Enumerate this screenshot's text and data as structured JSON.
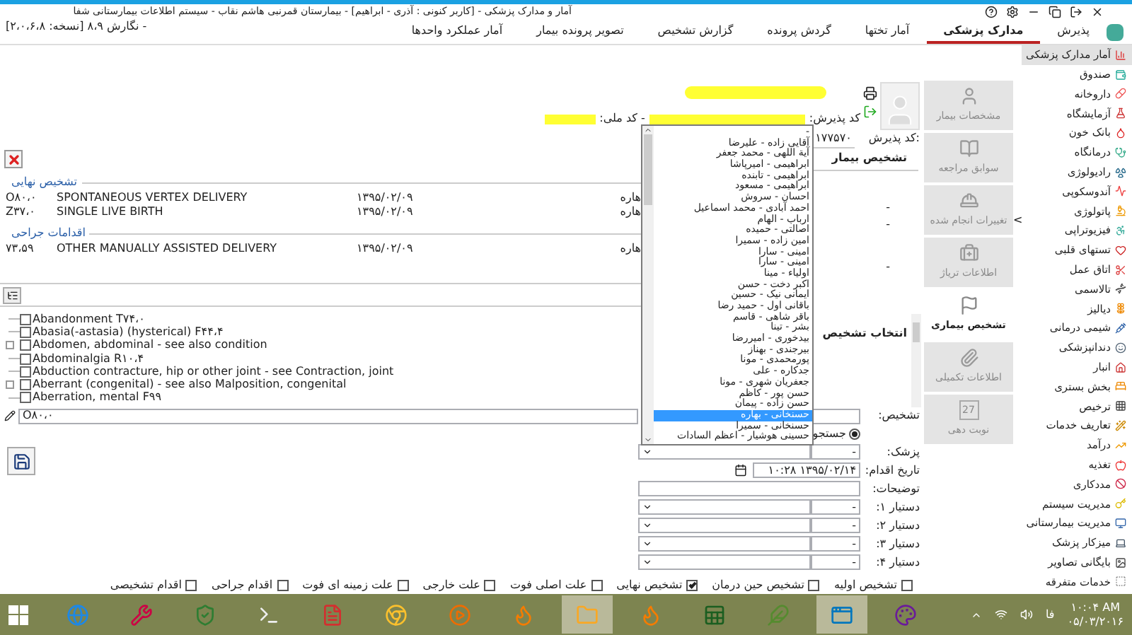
{
  "window": {
    "title": "آمار و مدارک پزشکی - [کاربر کنونی : آذری - ابراهیم] - بیمارستان قمرنبی هاشم نقاب - سیستم اطلاعات بیمارستانی شفا",
    "title_continuation": "- نگارش ۸،۹ [نسخه: ۲،۰،۶،۸]"
  },
  "menu_tabs": [
    {
      "label": "پذیرش",
      "selected": false
    },
    {
      "label": "مدارک پزشکی",
      "selected": true
    },
    {
      "label": "آمار تختها",
      "selected": false
    },
    {
      "label": "گردش پرونده",
      "selected": false
    },
    {
      "label": "گزارش تشخیص",
      "selected": false
    },
    {
      "label": "تصویر پرونده بیمار",
      "selected": false
    },
    {
      "label": "آمار عملکرد واحدها",
      "selected": false
    }
  ],
  "patient": {
    "info_label": "کد پذیرش:",
    "national_id_label": "- کد ملی:",
    "admission_label": "کد پذیرش:",
    "admission_value": "۱۷۷۵۷۰"
  },
  "diagnosis_groups": [
    {
      "title": "تشخیص نهایی",
      "rows": [
        {
          "code": "O۸۰،۰",
          "description": "SPONTANEOUS VERTEX DELIVERY",
          "date": "۱۳۹۵/۰۲/۰۹",
          "column_4": "هاره"
        },
        {
          "code": "Z۳۷،۰",
          "description": "SINGLE LIVE BIRTH",
          "date": "۱۳۹۵/۰۲/۰۹",
          "column_4": "هاره"
        }
      ]
    },
    {
      "title": "اقدامات جراحی",
      "rows": [
        {
          "code": "۷۳،۵۹",
          "description": "OTHER MANUALLY ASSISTED DELIVERY",
          "date": "۱۳۹۵/۰۲/۰۹",
          "column_4": "هاره"
        }
      ]
    }
  ],
  "patient_diagnosis": {
    "title": "تشخیص بیمار",
    "dashes": [
      "-",
      "-",
      "-"
    ]
  },
  "diagnosis_tree": [
    {
      "label": "Abandonment T۷۴،۰",
      "checked": false,
      "expandable": false
    },
    {
      "label": "Abasia(-astasia) (hysterical) F۴۴،۴",
      "checked": false,
      "expandable": false
    },
    {
      "label": "Abdomen, abdominal - see also condition",
      "checked": false,
      "expandable": true
    },
    {
      "label": "Abdominalgia R۱۰،۴",
      "checked": false,
      "expandable": false
    },
    {
      "label": "Abduction contracture, hip or other joint - see Contraction, joint",
      "checked": false,
      "expandable": false
    },
    {
      "label": "Aberrant (congenital) - see also Malposition, congenital",
      "checked": false,
      "expandable": true
    },
    {
      "label": "Aberration, mental F۹۹",
      "checked": false,
      "expandable": false
    }
  ],
  "code_input": {
    "value": "O۸۰،۰"
  },
  "select_diagnosis": {
    "title": "انتخاب تشخیص"
  },
  "collapse_arrow": "<",
  "form": {
    "diagnosis_label": "تشخیص:",
    "search_radio": {
      "label": "جستجو",
      "selected": true
    },
    "doctor_label": "پزشک:",
    "doctor_code": "-",
    "date_label": "تاریخ اقدام:",
    "date_value": "۱۳۹۵/۰۲/۱۴ ۱۰:۲۸",
    "notes_label": "توضیحات:",
    "assistants": [
      {
        "label": "دستیار ۱:",
        "code": "-"
      },
      {
        "label": "دستیار ۲:",
        "code": "-"
      },
      {
        "label": "دستیار ۳:",
        "code": "-"
      },
      {
        "label": "دستیار ۴:",
        "code": "-"
      }
    ]
  },
  "diagnosis_types": [
    {
      "label": "تشخیص اولیه",
      "checked": false
    },
    {
      "label": "تشخیص حین درمان",
      "checked": false
    },
    {
      "label": "تشخیص نهایی",
      "checked": true
    },
    {
      "label": "علت اصلی فوت",
      "checked": false
    },
    {
      "label": "علت خارجی",
      "checked": false
    },
    {
      "label": "علت زمینه ای فوت",
      "checked": false
    },
    {
      "label": "اقدام جراحی",
      "checked": false
    },
    {
      "label": "اقدام تشخیصی",
      "checked": false
    }
  ],
  "doctor_dropdown": {
    "items": [
      {
        "label": "-",
        "selected": false
      },
      {
        "label": "آقایی زاده - علیرضا",
        "selected": false
      },
      {
        "label": "آیة اللهی - محمد جعفر",
        "selected": false
      },
      {
        "label": "ابراهیمی - امیرپاشا",
        "selected": false
      },
      {
        "label": "ابراهیمی - تابنده",
        "selected": false
      },
      {
        "label": "ابراهیمی - مسعود",
        "selected": false
      },
      {
        "label": "احسان - سروش",
        "selected": false
      },
      {
        "label": "احمد آبادی - محمد اسماعیل",
        "selected": false
      },
      {
        "label": "ارباب - الهام",
        "selected": false
      },
      {
        "label": "اصالتی - حمیده",
        "selected": false
      },
      {
        "label": "امین زاده - سمیرا",
        "selected": false
      },
      {
        "label": "امینی - سارا",
        "selected": false
      },
      {
        "label": "امینی - سارا",
        "selected": false
      },
      {
        "label": "اولیاء - مینا",
        "selected": false
      },
      {
        "label": "اکبر دخت - حسن",
        "selected": false
      },
      {
        "label": "ایمانی نیک - حسین",
        "selected": false
      },
      {
        "label": "باقانی اول - حمید رضا",
        "selected": false
      },
      {
        "label": "باقر شاهی - قاسم",
        "selected": false
      },
      {
        "label": "بشر - تینا",
        "selected": false
      },
      {
        "label": "بیدخوری - امیررضا",
        "selected": false
      },
      {
        "label": "بیرجندی - بهناز",
        "selected": false
      },
      {
        "label": "پورمحمدی - مونا",
        "selected": false
      },
      {
        "label": "جدکاره - علی",
        "selected": false
      },
      {
        "label": "جعفریان شهری - مونا",
        "selected": false
      },
      {
        "label": "حسن پور - کاظم",
        "selected": false
      },
      {
        "label": "حسن زاده - پیمان",
        "selected": false
      },
      {
        "label": "حسنخانی - بهاره",
        "selected": true
      },
      {
        "label": "حسنخانی - سمیرا",
        "selected": false
      },
      {
        "label": "حسینی هوشیار - اعظم السادات",
        "selected": false
      }
    ]
  },
  "nav_panel": [
    {
      "label": "مشخصات بیمار",
      "selected": false
    },
    {
      "label": "سوابق مراجعه",
      "selected": false
    },
    {
      "label": "تغییرات انجام شده",
      "selected": false
    },
    {
      "label": "اطلاعات تریاژ",
      "selected": false
    },
    {
      "label": "تشخیص بیماری",
      "selected": true
    },
    {
      "label": "اطلاعات تکمیلی",
      "selected": false
    },
    {
      "label": "نوبت دهی",
      "selected": false
    }
  ],
  "calendar_day": "27",
  "sidebar": {
    "items": [
      {
        "label": "آمار مدارک پزشکی",
        "selected": true
      },
      {
        "label": "صندوق",
        "selected": false
      },
      {
        "label": "داروخانه",
        "selected": false
      },
      {
        "label": "آزمایشگاه",
        "selected": false
      },
      {
        "label": "بانک خون",
        "selected": false
      },
      {
        "label": "درمانگاه",
        "selected": false
      },
      {
        "label": "رادیولوژی",
        "selected": false
      },
      {
        "label": "آندوسکوپی",
        "selected": false
      },
      {
        "label": "پاتولوژی",
        "selected": false
      },
      {
        "label": "فیزیوتراپی",
        "selected": false
      },
      {
        "label": "تستهای قلبی",
        "selected": false
      },
      {
        "label": "اتاق عمل",
        "selected": false
      },
      {
        "label": "تالاسمی",
        "selected": false
      },
      {
        "label": "دیالیز",
        "selected": false
      },
      {
        "label": "شیمی درمانی",
        "selected": false
      },
      {
        "label": "دندانپزشکی",
        "selected": false
      },
      {
        "label": "انبار",
        "selected": false
      },
      {
        "label": "بخش بستری",
        "selected": false
      },
      {
        "label": "ترخیص",
        "selected": false
      },
      {
        "label": "تعاریف خدمات",
        "selected": false
      },
      {
        "label": "درآمد",
        "selected": false
      },
      {
        "label": "تغذیه",
        "selected": false
      },
      {
        "label": "مددکاری",
        "selected": false
      },
      {
        "label": "مدیریت سیستم",
        "selected": false
      },
      {
        "label": "مدیریت بیمارستانی",
        "selected": false
      },
      {
        "label": "میزکار پزشک",
        "selected": false
      },
      {
        "label": "بایگانی تصاویر",
        "selected": false
      },
      {
        "label": "خدمات متفرقه",
        "selected": false
      }
    ]
  },
  "taskbar": {
    "apps": [
      {
        "kind": "browser",
        "active": false
      },
      {
        "kind": "tool",
        "active": false
      },
      {
        "kind": "shield",
        "active": false
      },
      {
        "kind": "terminal",
        "active": false
      },
      {
        "kind": "pdf",
        "active": false
      },
      {
        "kind": "chrome",
        "active": false
      },
      {
        "kind": "media",
        "active": false
      },
      {
        "kind": "firefox",
        "active": false
      },
      {
        "kind": "folder",
        "active": true
      },
      {
        "kind": "firefox",
        "active": false
      },
      {
        "kind": "excel",
        "active": false
      },
      {
        "kind": "notes",
        "active": false
      },
      {
        "kind": "app",
        "active": true
      },
      {
        "kind": "paint",
        "active": false
      }
    ],
    "language": "فا",
    "time": "۱۰:۰۴ AM",
    "date": "۰۵/۰۳/۲۰۱۶"
  }
}
